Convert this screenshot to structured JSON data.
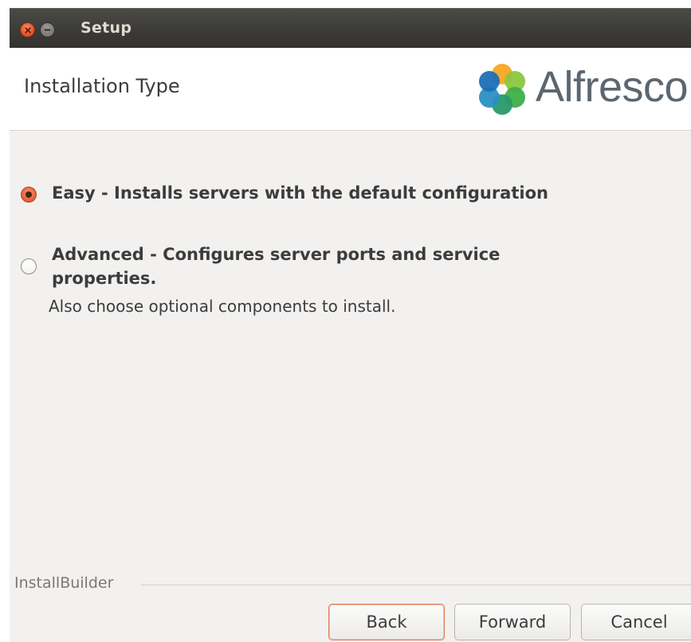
{
  "window": {
    "title": "Setup"
  },
  "header": {
    "title": "Installation Type",
    "logo_text": "Alfresco"
  },
  "options": {
    "easy": {
      "label": "Easy - Installs servers with the default configuration",
      "selected": true
    },
    "advanced": {
      "label_line1": "Advanced - Configures server ports and service",
      "label_line2": "properties.",
      "description": "Also choose optional components to install.",
      "selected": false
    }
  },
  "footer": {
    "brand": "InstallBuilder",
    "back_label": "Back",
    "forward_label": "Forward",
    "cancel_label": "Cancel"
  },
  "colors": {
    "accent": "#e5653b",
    "titlebar": "#3c3b37",
    "panel": "#f2f1f0"
  }
}
